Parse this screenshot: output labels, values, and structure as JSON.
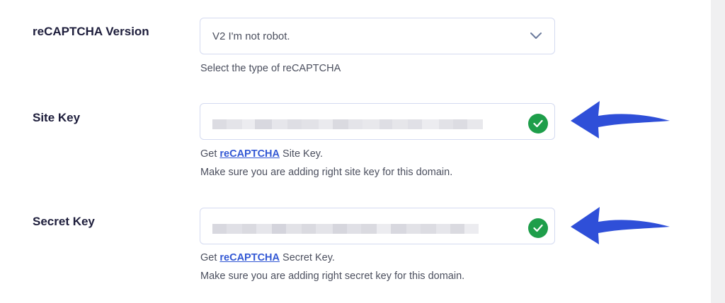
{
  "version": {
    "label": "reCAPTCHA Version",
    "selected": "V2 I'm not robot.",
    "help": "Select the type of reCAPTCHA"
  },
  "site_key": {
    "label": "Site Key",
    "help_prefix": "Get",
    "help_link": "reCAPTCHA",
    "help_suffix": "Site Key.",
    "help_line2": "Make sure you are adding right site key for this domain."
  },
  "secret_key": {
    "label": "Secret Key",
    "help_prefix": "Get",
    "help_link": "reCAPTCHA",
    "help_suffix": "Secret Key.",
    "help_line2": "Make sure you are adding right secret key for this domain."
  },
  "icons": {
    "chevron": "chevron-down-icon",
    "check": "check-circle-icon",
    "arrow": "arrow-left-icon"
  },
  "colors": {
    "label": "#1d1d3b",
    "link": "#3358d4",
    "check": "#1e9e4a",
    "arrow": "#2f4fd8",
    "border": "#d4daf0"
  }
}
